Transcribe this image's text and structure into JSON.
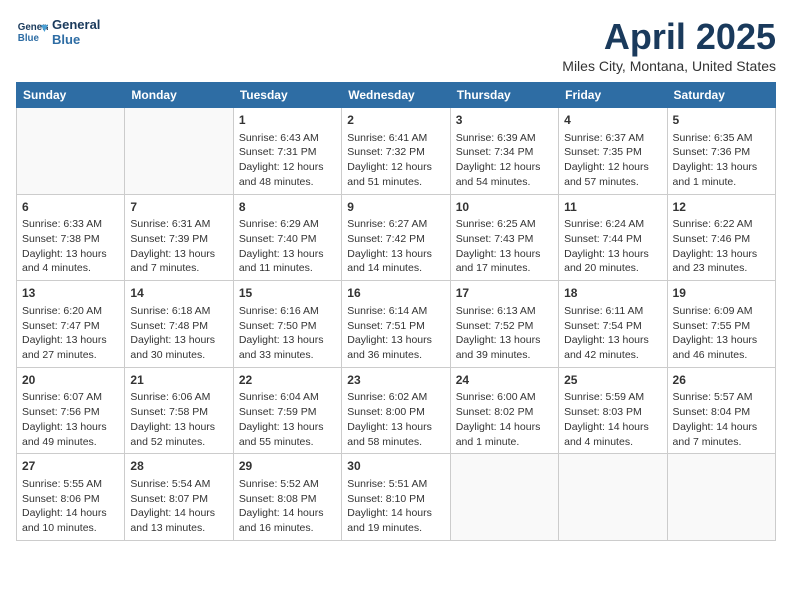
{
  "header": {
    "logo_line1": "General",
    "logo_line2": "Blue",
    "title": "April 2025",
    "subtitle": "Miles City, Montana, United States"
  },
  "days_of_week": [
    "Sunday",
    "Monday",
    "Tuesday",
    "Wednesday",
    "Thursday",
    "Friday",
    "Saturday"
  ],
  "weeks": [
    [
      {
        "day": "",
        "info": ""
      },
      {
        "day": "",
        "info": ""
      },
      {
        "day": "1",
        "info": "Sunrise: 6:43 AM\nSunset: 7:31 PM\nDaylight: 12 hours and 48 minutes."
      },
      {
        "day": "2",
        "info": "Sunrise: 6:41 AM\nSunset: 7:32 PM\nDaylight: 12 hours and 51 minutes."
      },
      {
        "day": "3",
        "info": "Sunrise: 6:39 AM\nSunset: 7:34 PM\nDaylight: 12 hours and 54 minutes."
      },
      {
        "day": "4",
        "info": "Sunrise: 6:37 AM\nSunset: 7:35 PM\nDaylight: 12 hours and 57 minutes."
      },
      {
        "day": "5",
        "info": "Sunrise: 6:35 AM\nSunset: 7:36 PM\nDaylight: 13 hours and 1 minute."
      }
    ],
    [
      {
        "day": "6",
        "info": "Sunrise: 6:33 AM\nSunset: 7:38 PM\nDaylight: 13 hours and 4 minutes."
      },
      {
        "day": "7",
        "info": "Sunrise: 6:31 AM\nSunset: 7:39 PM\nDaylight: 13 hours and 7 minutes."
      },
      {
        "day": "8",
        "info": "Sunrise: 6:29 AM\nSunset: 7:40 PM\nDaylight: 13 hours and 11 minutes."
      },
      {
        "day": "9",
        "info": "Sunrise: 6:27 AM\nSunset: 7:42 PM\nDaylight: 13 hours and 14 minutes."
      },
      {
        "day": "10",
        "info": "Sunrise: 6:25 AM\nSunset: 7:43 PM\nDaylight: 13 hours and 17 minutes."
      },
      {
        "day": "11",
        "info": "Sunrise: 6:24 AM\nSunset: 7:44 PM\nDaylight: 13 hours and 20 minutes."
      },
      {
        "day": "12",
        "info": "Sunrise: 6:22 AM\nSunset: 7:46 PM\nDaylight: 13 hours and 23 minutes."
      }
    ],
    [
      {
        "day": "13",
        "info": "Sunrise: 6:20 AM\nSunset: 7:47 PM\nDaylight: 13 hours and 27 minutes."
      },
      {
        "day": "14",
        "info": "Sunrise: 6:18 AM\nSunset: 7:48 PM\nDaylight: 13 hours and 30 minutes."
      },
      {
        "day": "15",
        "info": "Sunrise: 6:16 AM\nSunset: 7:50 PM\nDaylight: 13 hours and 33 minutes."
      },
      {
        "day": "16",
        "info": "Sunrise: 6:14 AM\nSunset: 7:51 PM\nDaylight: 13 hours and 36 minutes."
      },
      {
        "day": "17",
        "info": "Sunrise: 6:13 AM\nSunset: 7:52 PM\nDaylight: 13 hours and 39 minutes."
      },
      {
        "day": "18",
        "info": "Sunrise: 6:11 AM\nSunset: 7:54 PM\nDaylight: 13 hours and 42 minutes."
      },
      {
        "day": "19",
        "info": "Sunrise: 6:09 AM\nSunset: 7:55 PM\nDaylight: 13 hours and 46 minutes."
      }
    ],
    [
      {
        "day": "20",
        "info": "Sunrise: 6:07 AM\nSunset: 7:56 PM\nDaylight: 13 hours and 49 minutes."
      },
      {
        "day": "21",
        "info": "Sunrise: 6:06 AM\nSunset: 7:58 PM\nDaylight: 13 hours and 52 minutes."
      },
      {
        "day": "22",
        "info": "Sunrise: 6:04 AM\nSunset: 7:59 PM\nDaylight: 13 hours and 55 minutes."
      },
      {
        "day": "23",
        "info": "Sunrise: 6:02 AM\nSunset: 8:00 PM\nDaylight: 13 hours and 58 minutes."
      },
      {
        "day": "24",
        "info": "Sunrise: 6:00 AM\nSunset: 8:02 PM\nDaylight: 14 hours and 1 minute."
      },
      {
        "day": "25",
        "info": "Sunrise: 5:59 AM\nSunset: 8:03 PM\nDaylight: 14 hours and 4 minutes."
      },
      {
        "day": "26",
        "info": "Sunrise: 5:57 AM\nSunset: 8:04 PM\nDaylight: 14 hours and 7 minutes."
      }
    ],
    [
      {
        "day": "27",
        "info": "Sunrise: 5:55 AM\nSunset: 8:06 PM\nDaylight: 14 hours and 10 minutes."
      },
      {
        "day": "28",
        "info": "Sunrise: 5:54 AM\nSunset: 8:07 PM\nDaylight: 14 hours and 13 minutes."
      },
      {
        "day": "29",
        "info": "Sunrise: 5:52 AM\nSunset: 8:08 PM\nDaylight: 14 hours and 16 minutes."
      },
      {
        "day": "30",
        "info": "Sunrise: 5:51 AM\nSunset: 8:10 PM\nDaylight: 14 hours and 19 minutes."
      },
      {
        "day": "",
        "info": ""
      },
      {
        "day": "",
        "info": ""
      },
      {
        "day": "",
        "info": ""
      }
    ]
  ]
}
